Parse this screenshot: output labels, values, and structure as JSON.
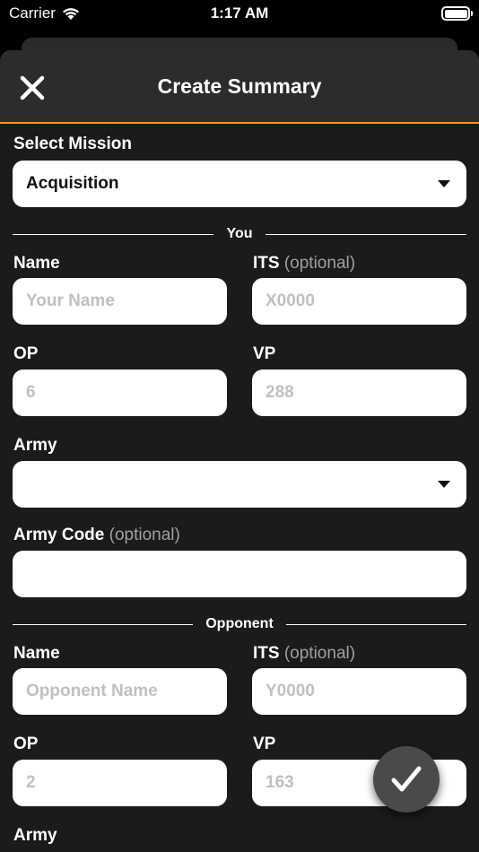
{
  "status_bar": {
    "carrier": "Carrier",
    "time": "1:17 AM"
  },
  "header": {
    "title": "Create Summary"
  },
  "mission": {
    "label": "Select Mission",
    "selected": "Acquisition"
  },
  "you": {
    "section_label": "You",
    "name_label": "Name",
    "name_placeholder": "Your Name",
    "its_label": "ITS",
    "its_optional": "(optional)",
    "its_placeholder": "X0000",
    "op_label": "OP",
    "op_placeholder": "6",
    "vp_label": "VP",
    "vp_placeholder": "288",
    "army_label": "Army",
    "army_selected": "",
    "army_code_label": "Army Code",
    "army_code_optional": "(optional)",
    "army_code_value": ""
  },
  "opponent": {
    "section_label": "Opponent",
    "name_label": "Name",
    "name_placeholder": "Opponent Name",
    "its_label": "ITS",
    "its_optional": "(optional)",
    "its_placeholder": "Y0000",
    "op_label": "OP",
    "op_placeholder": "2",
    "vp_label": "VP",
    "vp_placeholder": "163",
    "army_label": "Army"
  },
  "colors": {
    "accent": "#f39c12",
    "sheet": "#1b1b1b",
    "header": "#2c2c2c"
  },
  "icons": {
    "close": "close-icon",
    "submit": "checkmark-icon",
    "wifi": "wifi-icon",
    "battery": "battery-icon"
  }
}
